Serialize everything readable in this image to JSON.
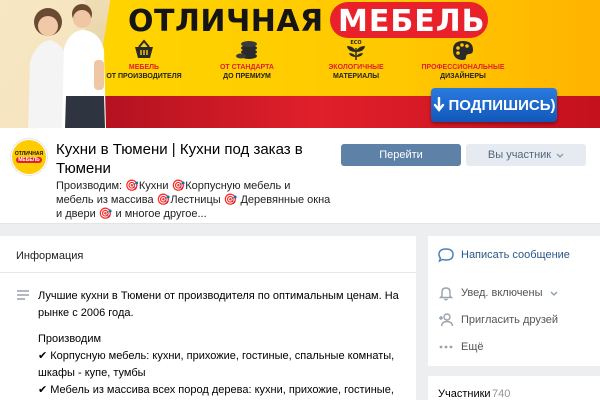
{
  "cover": {
    "title_part1": "ОТЛИЧНАЯ",
    "title_part2": "МЕБЕЛЬ",
    "features": [
      {
        "line1": "МЕБЕЛЬ",
        "line2": "ОТ ПРОИЗВОДИТЕЛЯ",
        "icon": "basket-icon"
      },
      {
        "line1": "ОТ СТАНДАРТА",
        "line2": "ДО ПРЕМИУМ",
        "icon": "coins-icon"
      },
      {
        "line1": "ЭКОЛОГИЧНЫЕ",
        "line2": "МАТЕРИАЛЫ",
        "icon": "eco-leaves-icon",
        "badge": "ECO"
      },
      {
        "line1": "ПРОФЕССИОНАЛЬНЫЕ",
        "line2": "ДИЗАЙНЕРЫ",
        "icon": "palette-icon"
      }
    ],
    "subscribe_label": "ПОДПИШИСЬ)",
    "colors": {
      "yellow": "#ffc800",
      "red": "#e0202a",
      "blue": "#1f6fd6"
    }
  },
  "group": {
    "avatar_line1": "ОТЛИЧНАЯ",
    "avatar_line2": "МЕБЕЛЬ",
    "name": "Кухни в Тюмени | Кухни под заказ в Тюмени",
    "description": "Производим: 🎯Кухни 🎯Корпусную мебель и мебель из массива 🎯Лестницы 🎯 Деревянные окна и двери 🎯 и многое другое...",
    "button_go": "Перейти",
    "button_member": "Вы участник"
  },
  "info": {
    "title": "Информация",
    "paragraph1": "Лучшие кухни в Тюмени от производителя по оптимальным ценам. На рынке с 2006 года.",
    "heading": "Производим",
    "line1": "✔ Корпусную мебель: кухни, прихожие, гостиные, спальные комнаты, шкафы - купе, тумбы",
    "line2": "✔ Мебель из массива всех пород дерева: кухни, прихожие, гостиные, спальные комнаты, шкафы - купе, тумбы"
  },
  "actions": {
    "message": "Написать сообщение",
    "notifications": "Увед. включены",
    "invite": "Пригласить друзей",
    "more": "Ещё",
    "members_label": "Участники",
    "members_count": "740"
  },
  "colors": {
    "vk_button": "#5e81a8",
    "vk_link": "#2a5885",
    "page_bg": "#edeef0"
  }
}
